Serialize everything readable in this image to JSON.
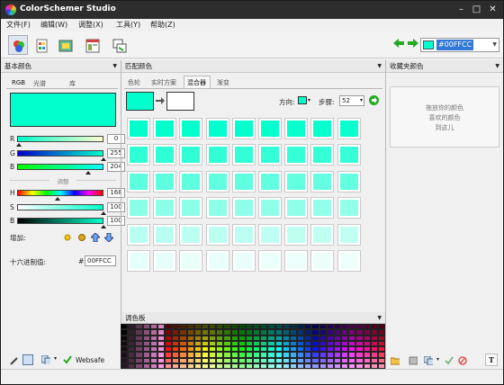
{
  "window": {
    "title": "ColorSchemer Studio"
  },
  "menu": [
    "文件(F)",
    "编辑(W)",
    "调整(X)",
    "工具(Y)",
    "帮助(Z)"
  ],
  "hex_combo": {
    "value": "#00FFCC",
    "swatch": "#00ffcc"
  },
  "left_panel": {
    "header": "基本颜色",
    "tabs": [
      "RGB",
      "光谱",
      "库"
    ],
    "current_color": "#00ffcc",
    "rgb": {
      "r_label": "R",
      "r": "0",
      "g_label": "G",
      "g": "255",
      "b_label": "B",
      "b": "204"
    },
    "adjust_label": "调整",
    "hsb": {
      "h_label": "H",
      "h": "168",
      "s_label": "S",
      "s": "100",
      "b_label": "B",
      "b": "100"
    },
    "add_label": "增加:",
    "hex_label": "十六进制值:",
    "hex_prefix": "#",
    "hex_value": "00FFCC",
    "websafe_label": "Websafe"
  },
  "center_panel": {
    "header": "匹配颜色",
    "tabs": [
      "色轮",
      "实时方案",
      "混合器",
      "渐变"
    ],
    "active_tab": "混合器",
    "mix_from": "#00ffcc",
    "mix_to": "#ffffff",
    "direction_label": "方向:",
    "steps_label": "步骤:",
    "steps_value": "52",
    "palette_header": "调色板"
  },
  "right_panel": {
    "header": "收藏夹颜色",
    "placeholder_lines": [
      "拖放你的颜色",
      "喜欢的颜色",
      "到这儿"
    ]
  },
  "colors": {
    "accent": "#00ffcc",
    "selection": "#3178d6"
  }
}
